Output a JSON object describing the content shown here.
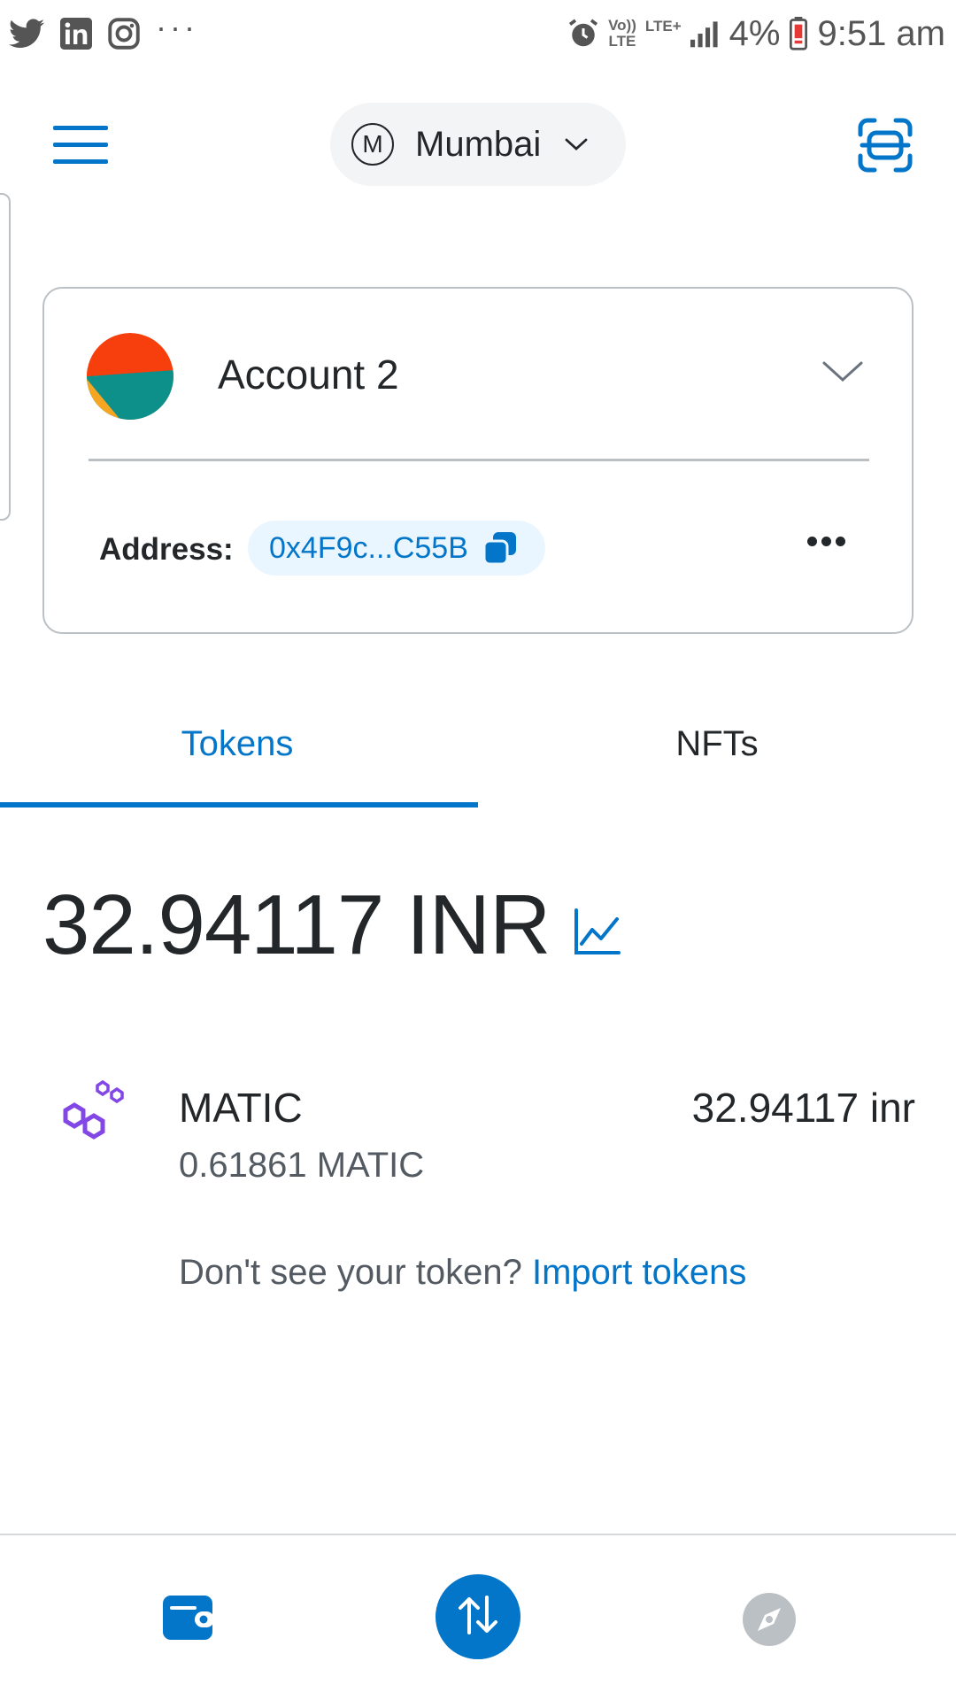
{
  "status_bar": {
    "time": "9:51 am",
    "battery": "4%",
    "volte": "Vo))\nLTE",
    "lte_plus": "LTE+",
    "overflow": "···",
    "app_icons": [
      "twitter-icon",
      "linkedin-icon",
      "instagram-icon"
    ]
  },
  "header": {
    "network_initial": "M",
    "network_name": "Mumbai"
  },
  "account": {
    "name": "Account 2",
    "address_label": "Address:",
    "address_short": "0x4F9c...C55B"
  },
  "tabs": [
    {
      "label": "Tokens",
      "active": true
    },
    {
      "label": "NFTs",
      "active": false
    }
  ],
  "balance": {
    "value": "32.94117 INR"
  },
  "tokens": [
    {
      "symbol": "MATIC",
      "amount": "0.61861 MATIC",
      "fiat": "32.94117 inr"
    }
  ],
  "import": {
    "prompt": "Don't see your token?",
    "link": "Import tokens"
  },
  "colors": {
    "accent": "#0376c9",
    "text": "#24272a",
    "muted": "#535a61",
    "matic": "#8247e5"
  },
  "bottom_nav": [
    "wallet-icon",
    "swap-icon",
    "browser-icon"
  ]
}
